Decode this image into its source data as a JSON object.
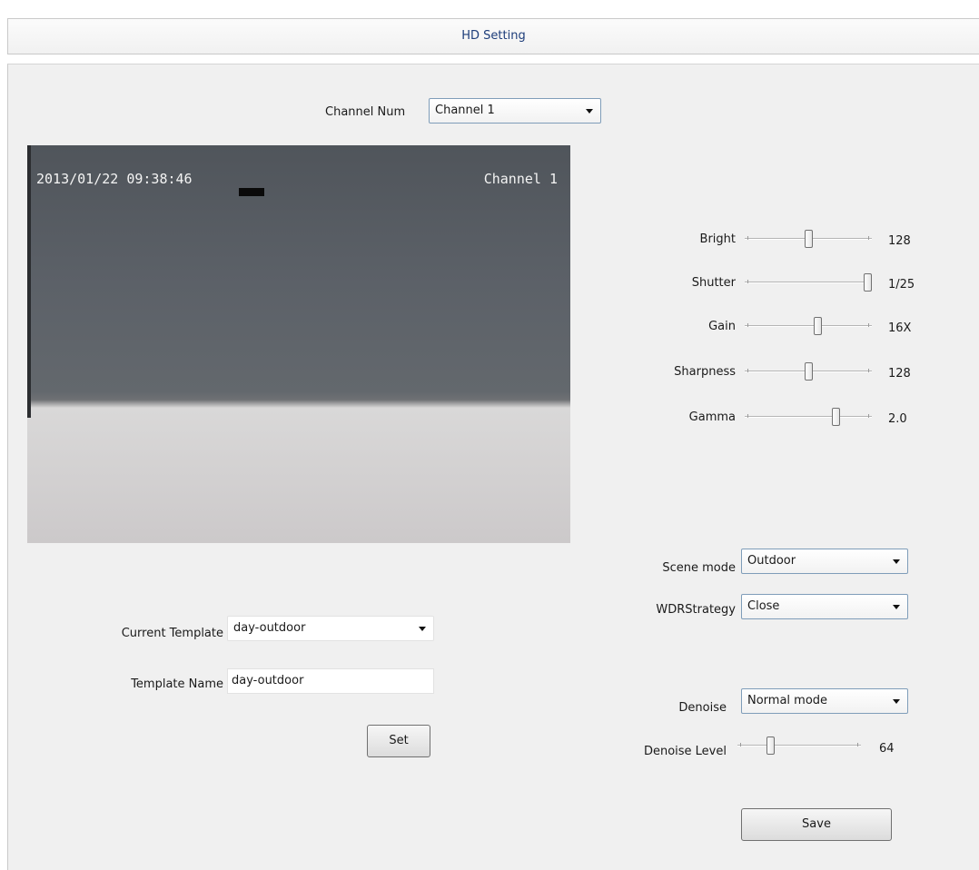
{
  "window": {
    "title": "HD Setting"
  },
  "channel": {
    "label": "Channel Num",
    "selected": "Channel 1"
  },
  "video": {
    "timestamp": "2013/01/22 09:38:46",
    "channel_osd": "Channel 1"
  },
  "sliders": [
    {
      "label": "Bright",
      "value": "128",
      "fraction": 0.5
    },
    {
      "label": "Shutter",
      "value": "1/25",
      "fraction": 1.0
    },
    {
      "label": "Gain",
      "value": "16X",
      "fraction": 0.58
    },
    {
      "label": "Sharpness",
      "value": "128",
      "fraction": 0.5
    },
    {
      "label": "Gamma",
      "value": "2.0",
      "fraction": 0.73
    }
  ],
  "scene": {
    "label": "Scene mode",
    "selected": "Outdoor"
  },
  "wdr": {
    "label": "WDRStrategy",
    "selected": "Close"
  },
  "denoise": {
    "label": "Denoise",
    "selected": "Normal mode"
  },
  "denoise_level": {
    "label": "Denoise Level",
    "value": "64",
    "fraction": 0.25
  },
  "template": {
    "current_label": "Current Template",
    "current_value": "day-outdoor",
    "name_label": "Template Name",
    "name_value": "day-outdoor",
    "set_label": "Set"
  },
  "save_label": "Save"
}
